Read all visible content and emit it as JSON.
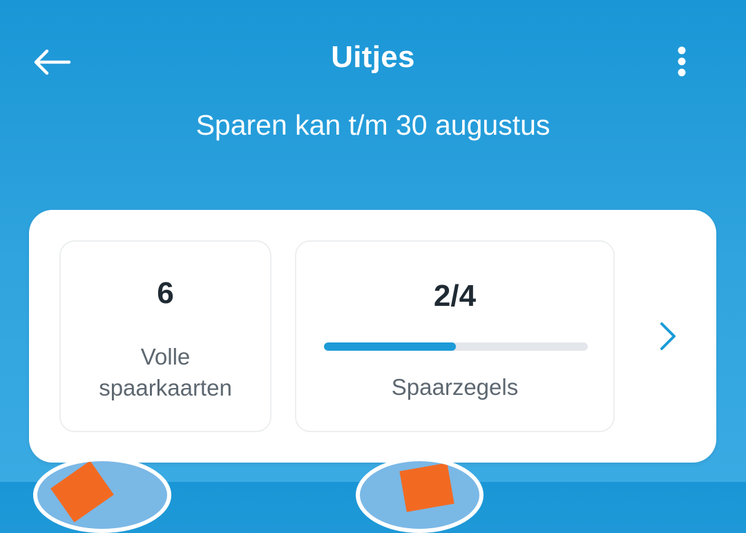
{
  "header": {
    "title": "Uitjes",
    "back_icon": "arrow-left-icon",
    "menu_icon": "more-vertical-icon"
  },
  "subtitle": "Sparen kan t/m 30 augustus",
  "summary": {
    "full_cards": {
      "value": "6",
      "label_line1": "Volle",
      "label_line2": "spaarkaarten"
    },
    "stamps": {
      "value": "2/4",
      "progress": 0.5,
      "label": "Spaarzegels"
    },
    "chevron_icon": "chevron-right-icon"
  },
  "colors": {
    "background": "#1a96d6",
    "accent": "#1c9bd8",
    "card": "#ffffff",
    "badge_orange": "#f26a22"
  }
}
